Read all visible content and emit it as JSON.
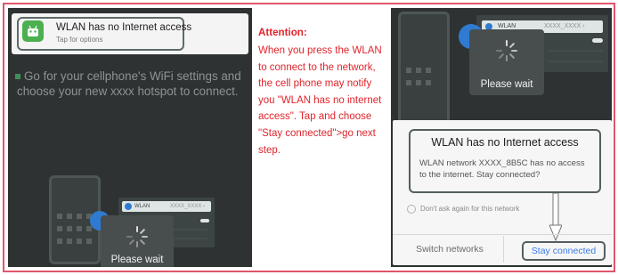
{
  "left": {
    "notification": {
      "title": "WLAN has no Internet access",
      "subtitle": "Tap for options"
    },
    "instruction": "Go for your cellphone's WiFi settings and choose your new  xxxx  hotspot to connect.",
    "wlan_row": {
      "label": "WLAN",
      "ssid": "XXXX_XXXX ›"
    },
    "wait_text": "Please wait"
  },
  "middle": {
    "title": "Attention:",
    "body": "When you press the WLAN to connect to the network, the cell phone may notify you \"WLAN has no internet access\". Tap and choose \"Stay connected\">go next step."
  },
  "right": {
    "wlan_row": {
      "label": "WLAN",
      "ssid": "XXXX_XXXX ›"
    },
    "wait_text": "Please wait",
    "dialog": {
      "title": "WLAN has no Internet access",
      "body": "WLAN network XXXX_8B5C has no access to the internet. Stay connected?",
      "checkbox_label": "Don't ask again for this network",
      "switch_button": "Switch networks",
      "stay_button": "Stay connected"
    }
  },
  "colors": {
    "accent_red": "#e0232b",
    "border": "#e0566a",
    "link_blue": "#3a7ce4"
  }
}
